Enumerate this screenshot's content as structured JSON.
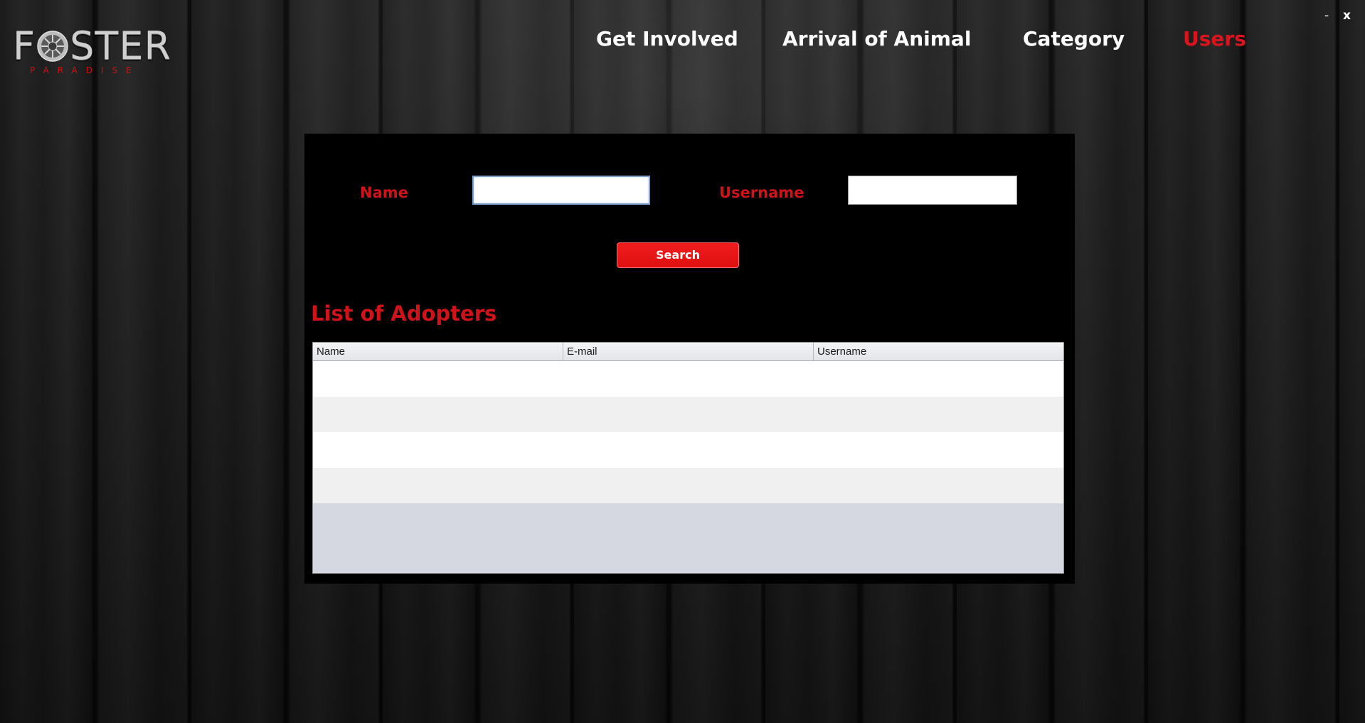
{
  "app": {
    "logo": {
      "text_left": "F",
      "text_right": "STER",
      "subtitle": "PARADISE"
    },
    "window_controls": {
      "minimize": "-",
      "close": "x"
    }
  },
  "nav": {
    "items": [
      {
        "label": "Get Involved",
        "active": false
      },
      {
        "label": "Arrival of Animal",
        "active": false
      },
      {
        "label": "Category",
        "active": false
      },
      {
        "label": "Users",
        "active": true
      }
    ]
  },
  "search_form": {
    "name_label": "Name",
    "name_value": "",
    "username_label": "Username",
    "username_value": "",
    "search_button": "Search"
  },
  "adopters": {
    "title": "List of Adopters",
    "columns": [
      "Name",
      "E-mail",
      "Username"
    ],
    "rows": [
      [
        "",
        "",
        ""
      ],
      [
        "",
        "",
        ""
      ],
      [
        "",
        "",
        ""
      ],
      [
        "",
        "",
        ""
      ]
    ]
  },
  "colors": {
    "accent_red": "#d0121b",
    "nav_active": "#d9141e",
    "button_red": "#e81515",
    "panel_bg": "#000000"
  }
}
